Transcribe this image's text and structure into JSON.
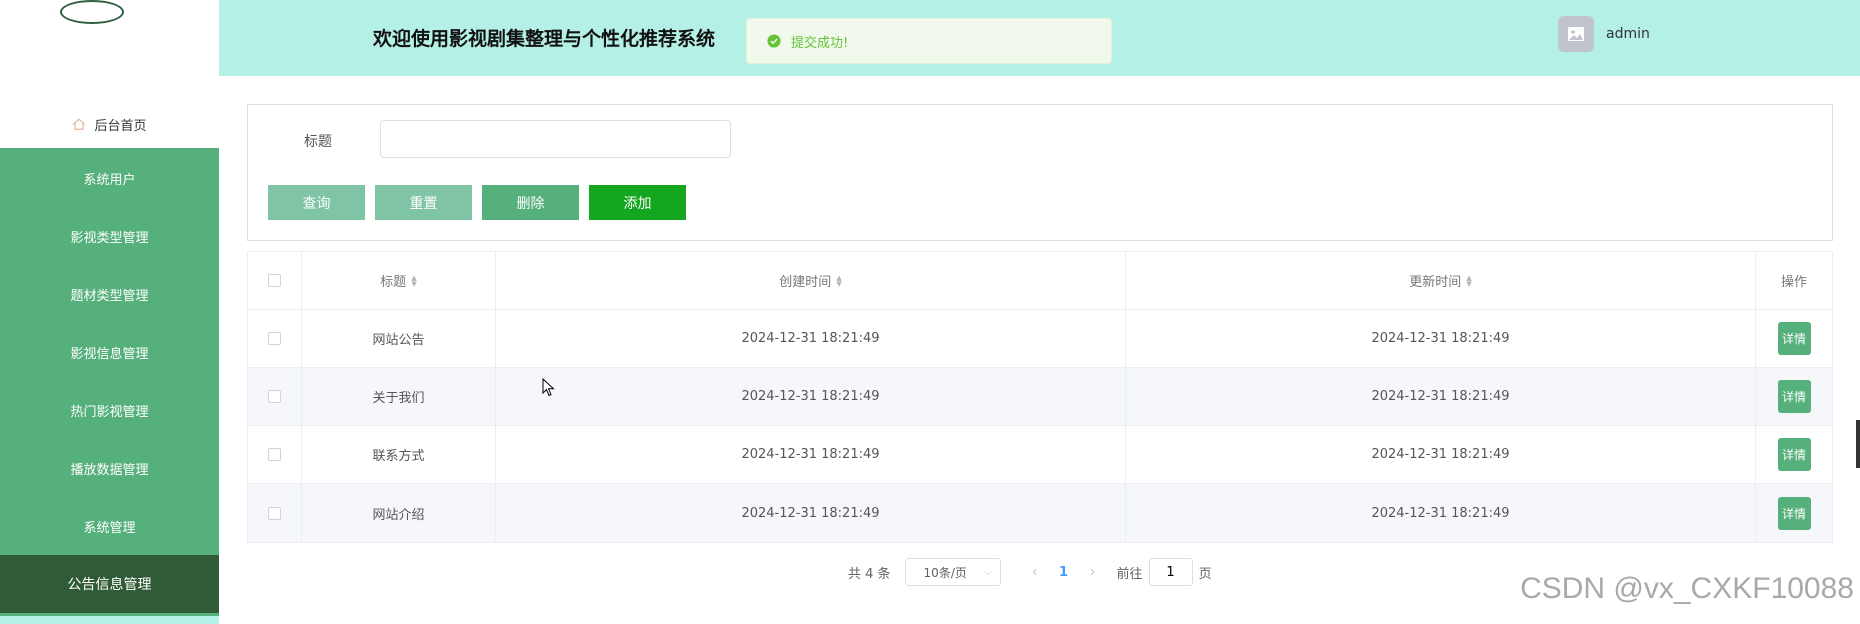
{
  "app": {
    "title": "欢迎使用影视剧集整理与个性化推荐系统"
  },
  "toast": {
    "message": "提交成功!"
  },
  "user": {
    "name": "admin"
  },
  "sidebar": {
    "home": "后台首页",
    "items": [
      {
        "label": "系统用户"
      },
      {
        "label": "影视类型管理"
      },
      {
        "label": "题材类型管理"
      },
      {
        "label": "影视信息管理"
      },
      {
        "label": "热门影视管理"
      },
      {
        "label": "播放数据管理"
      },
      {
        "label": "系统管理"
      },
      {
        "label": "公告信息管理",
        "active": true
      }
    ]
  },
  "search": {
    "title_label": "标题",
    "title_value": "",
    "buttons": {
      "query": "查询",
      "reset": "重置",
      "delete": "删除",
      "add": "添加"
    }
  },
  "table": {
    "columns": {
      "title": "标题",
      "created": "创建时间",
      "updated": "更新时间",
      "action": "操作"
    },
    "rows": [
      {
        "title": "网站公告",
        "created": "2024-12-31 18:21:49",
        "updated": "2024-12-31 18:21:49",
        "action": "详情"
      },
      {
        "title": "关于我们",
        "created": "2024-12-31 18:21:49",
        "updated": "2024-12-31 18:21:49",
        "action": "详情"
      },
      {
        "title": "联系方式",
        "created": "2024-12-31 18:21:49",
        "updated": "2024-12-31 18:21:49",
        "action": "详情"
      },
      {
        "title": "网站介绍",
        "created": "2024-12-31 18:21:49",
        "updated": "2024-12-31 18:21:49",
        "action": "详情"
      }
    ]
  },
  "pagination": {
    "total": "共 4 条",
    "page_size": "10条/页",
    "current_page": "1",
    "goto_prefix": "前往",
    "goto_value": "1",
    "goto_suffix": "页"
  },
  "watermark": "CSDN @vx_CXKF10088",
  "colors": {
    "sidebar": "#55b07b",
    "sidebar_active": "#2f5b36",
    "header": "#b4f0e5",
    "button_light": "#80c4a6",
    "button_add": "#13a61e",
    "success": "#67c23a"
  }
}
